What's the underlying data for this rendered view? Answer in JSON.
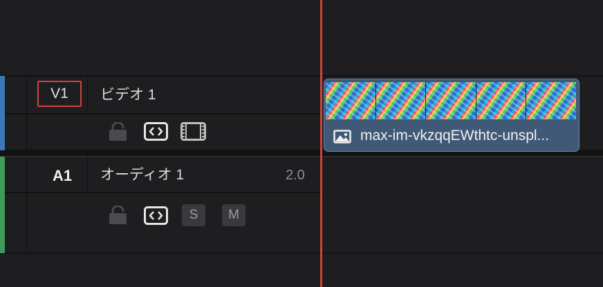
{
  "colors": {
    "background": "#1e1e20",
    "video_track": "#3c79b8",
    "audio_track": "#3e9c5a",
    "playhead": "#d0433b",
    "clip": "#3f5977",
    "track_label_selected_border": "#d0433b"
  },
  "tracks": {
    "video": {
      "id": "V1",
      "name": "ビデオ 1",
      "icons": [
        "lock-icon",
        "link-icon",
        "film-strip-icon"
      ]
    },
    "audio": {
      "id": "A1",
      "name": "オーディオ 1",
      "channels": "2.0",
      "solo_label": "S",
      "mute_label": "M",
      "icons": [
        "lock-icon",
        "link-icon"
      ]
    }
  },
  "clip": {
    "name": "max-im-vkzqqEWthtc-unspl...",
    "icon": "image-icon",
    "thumbnail_count": 5
  }
}
